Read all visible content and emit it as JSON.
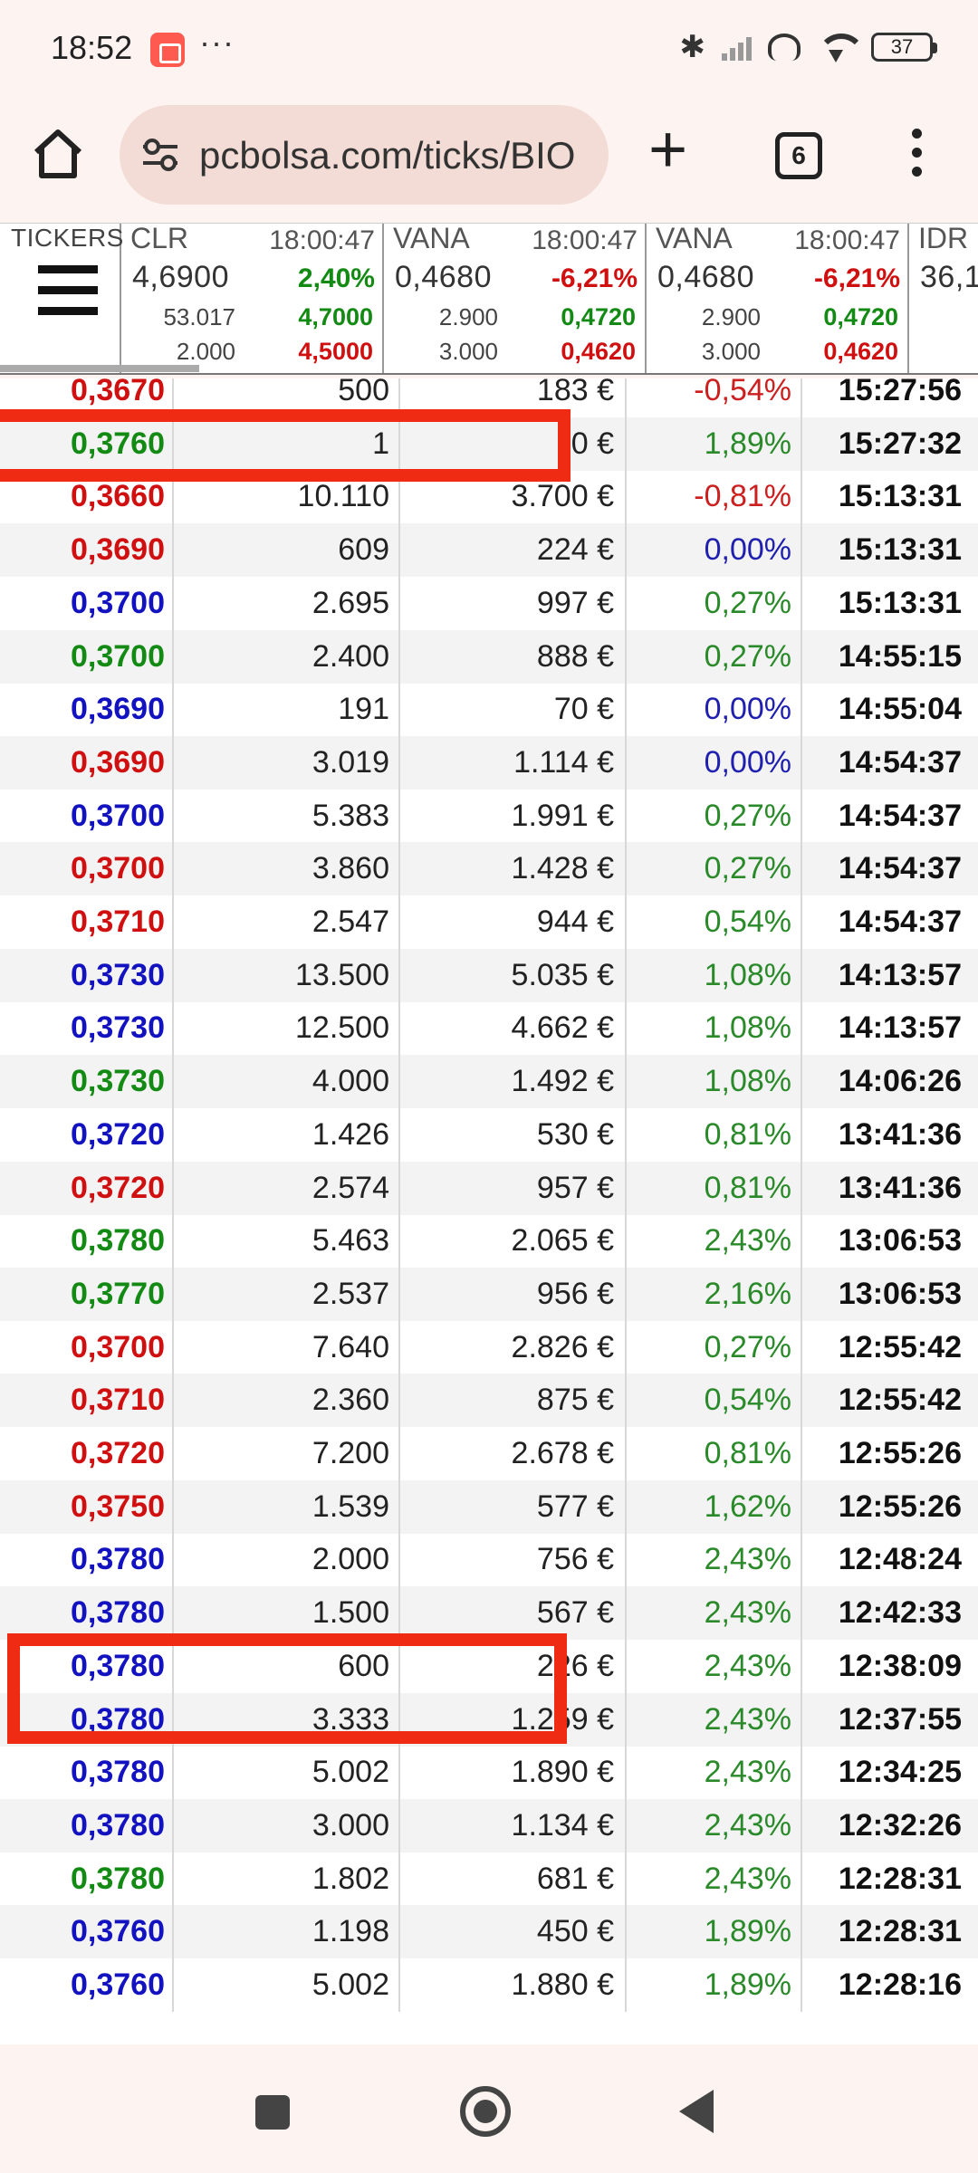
{
  "status_bar": {
    "time": "18:52",
    "more": "···",
    "battery": "37",
    "icons": [
      "bluetooth-icon",
      "signal-icon",
      "hotspot-icon",
      "wifi-icon",
      "battery-icon"
    ]
  },
  "browser": {
    "url": "pcbolsa.com/ticks/BIO",
    "tab_count": "6"
  },
  "tickers": {
    "menu_label": "TICKERS",
    "cards": [
      {
        "symbol": "CLR",
        "time": "18:00:47",
        "price": "4,6900",
        "change": "2,40%",
        "change_dir": "up",
        "vol1": "53.017",
        "vol2": "2.000",
        "high": "4,7000",
        "low": "4,5000"
      },
      {
        "symbol": "VANA",
        "time": "18:00:47",
        "price": "0,4680",
        "change": "-6,21%",
        "change_dir": "down",
        "vol1": "2.900",
        "vol2": "3.000",
        "high": "0,4720",
        "low": "0,4620"
      },
      {
        "symbol": "VANA",
        "time": "18:00:47",
        "price": "0,4680",
        "change": "-6,21%",
        "change_dir": "down",
        "vol1": "2.900",
        "vol2": "3.000",
        "high": "0,4720",
        "low": "0,4620"
      },
      {
        "symbol": "IDR",
        "time": "",
        "price": "36,1",
        "change": "",
        "change_dir": "",
        "vol1": "",
        "vol2": "",
        "high": "",
        "low": ""
      }
    ]
  },
  "ticks": [
    {
      "price": "0,3670",
      "price_color": "red",
      "volume": "500",
      "amount": "183 €",
      "pct": "-0,54%",
      "pct_color": "red",
      "time": "15:27:56"
    },
    {
      "price": "0,3760",
      "price_color": "green",
      "volume": "1",
      "amount": "0 €",
      "pct": "1,89%",
      "pct_color": "green",
      "time": "15:27:32"
    },
    {
      "price": "0,3660",
      "price_color": "red",
      "volume": "10.110",
      "amount": "3.700 €",
      "pct": "-0,81%",
      "pct_color": "red",
      "time": "15:13:31"
    },
    {
      "price": "0,3690",
      "price_color": "red",
      "volume": "609",
      "amount": "224 €",
      "pct": "0,00%",
      "pct_color": "blue",
      "time": "15:13:31"
    },
    {
      "price": "0,3700",
      "price_color": "blue",
      "volume": "2.695",
      "amount": "997 €",
      "pct": "0,27%",
      "pct_color": "green",
      "time": "15:13:31"
    },
    {
      "price": "0,3700",
      "price_color": "green",
      "volume": "2.400",
      "amount": "888 €",
      "pct": "0,27%",
      "pct_color": "green",
      "time": "14:55:15"
    },
    {
      "price": "0,3690",
      "price_color": "blue",
      "volume": "191",
      "amount": "70 €",
      "pct": "0,00%",
      "pct_color": "blue",
      "time": "14:55:04"
    },
    {
      "price": "0,3690",
      "price_color": "red",
      "volume": "3.019",
      "amount": "1.114 €",
      "pct": "0,00%",
      "pct_color": "blue",
      "time": "14:54:37"
    },
    {
      "price": "0,3700",
      "price_color": "blue",
      "volume": "5.383",
      "amount": "1.991 €",
      "pct": "0,27%",
      "pct_color": "green",
      "time": "14:54:37"
    },
    {
      "price": "0,3700",
      "price_color": "red",
      "volume": "3.860",
      "amount": "1.428 €",
      "pct": "0,27%",
      "pct_color": "green",
      "time": "14:54:37"
    },
    {
      "price": "0,3710",
      "price_color": "red",
      "volume": "2.547",
      "amount": "944 €",
      "pct": "0,54%",
      "pct_color": "green",
      "time": "14:54:37"
    },
    {
      "price": "0,3730",
      "price_color": "blue",
      "volume": "13.500",
      "amount": "5.035 €",
      "pct": "1,08%",
      "pct_color": "green",
      "time": "14:13:57"
    },
    {
      "price": "0,3730",
      "price_color": "blue",
      "volume": "12.500",
      "amount": "4.662 €",
      "pct": "1,08%",
      "pct_color": "green",
      "time": "14:13:57"
    },
    {
      "price": "0,3730",
      "price_color": "green",
      "volume": "4.000",
      "amount": "1.492 €",
      "pct": "1,08%",
      "pct_color": "green",
      "time": "14:06:26"
    },
    {
      "price": "0,3720",
      "price_color": "blue",
      "volume": "1.426",
      "amount": "530 €",
      "pct": "0,81%",
      "pct_color": "green",
      "time": "13:41:36"
    },
    {
      "price": "0,3720",
      "price_color": "red",
      "volume": "2.574",
      "amount": "957 €",
      "pct": "0,81%",
      "pct_color": "green",
      "time": "13:41:36"
    },
    {
      "price": "0,3780",
      "price_color": "green",
      "volume": "5.463",
      "amount": "2.065 €",
      "pct": "2,43%",
      "pct_color": "green",
      "time": "13:06:53"
    },
    {
      "price": "0,3770",
      "price_color": "green",
      "volume": "2.537",
      "amount": "956 €",
      "pct": "2,16%",
      "pct_color": "green",
      "time": "13:06:53"
    },
    {
      "price": "0,3700",
      "price_color": "red",
      "volume": "7.640",
      "amount": "2.826 €",
      "pct": "0,27%",
      "pct_color": "green",
      "time": "12:55:42"
    },
    {
      "price": "0,3710",
      "price_color": "red",
      "volume": "2.360",
      "amount": "875 €",
      "pct": "0,54%",
      "pct_color": "green",
      "time": "12:55:42"
    },
    {
      "price": "0,3720",
      "price_color": "red",
      "volume": "7.200",
      "amount": "2.678 €",
      "pct": "0,81%",
      "pct_color": "green",
      "time": "12:55:26"
    },
    {
      "price": "0,3750",
      "price_color": "red",
      "volume": "1.539",
      "amount": "577 €",
      "pct": "1,62%",
      "pct_color": "green",
      "time": "12:55:26"
    },
    {
      "price": "0,3780",
      "price_color": "blue",
      "volume": "2.000",
      "amount": "756 €",
      "pct": "2,43%",
      "pct_color": "green",
      "time": "12:48:24"
    },
    {
      "price": "0,3780",
      "price_color": "blue",
      "volume": "1.500",
      "amount": "567 €",
      "pct": "2,43%",
      "pct_color": "green",
      "time": "12:42:33"
    },
    {
      "price": "0,3780",
      "price_color": "blue",
      "volume": "600",
      "amount": "226 €",
      "pct": "2,43%",
      "pct_color": "green",
      "time": "12:38:09"
    },
    {
      "price": "0,3780",
      "price_color": "blue",
      "volume": "3.333",
      "amount": "1.259 €",
      "pct": "2,43%",
      "pct_color": "green",
      "time": "12:37:55"
    },
    {
      "price": "0,3780",
      "price_color": "blue",
      "volume": "5.002",
      "amount": "1.890 €",
      "pct": "2,43%",
      "pct_color": "green",
      "time": "12:34:25"
    },
    {
      "price": "0,3780",
      "price_color": "blue",
      "volume": "3.000",
      "amount": "1.134 €",
      "pct": "2,43%",
      "pct_color": "green",
      "time": "12:32:26"
    },
    {
      "price": "0,3780",
      "price_color": "green",
      "volume": "1.802",
      "amount": "681 €",
      "pct": "2,43%",
      "pct_color": "green",
      "time": "12:28:31"
    },
    {
      "price": "0,3760",
      "price_color": "blue",
      "volume": "1.198",
      "amount": "450 €",
      "pct": "1,89%",
      "pct_color": "green",
      "time": "12:28:31"
    },
    {
      "price": "0,3760",
      "price_color": "blue",
      "volume": "5.002",
      "amount": "1.880 €",
      "pct": "1,89%",
      "pct_color": "green",
      "time": "12:28:16"
    }
  ],
  "highlight_color": "#ef2b14"
}
